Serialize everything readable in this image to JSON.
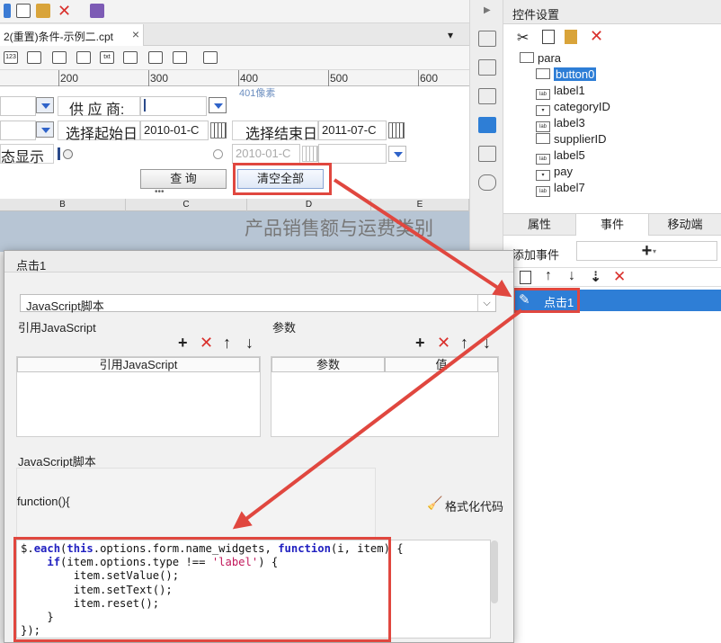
{
  "tab": {
    "title": "2(重置)条件-示例二.cpt",
    "close": "×"
  },
  "ruler": {
    "marks": [
      "200",
      "300",
      "400",
      "500",
      "600"
    ],
    "pixel_hint": "401像素"
  },
  "form": {
    "supplier_label": "供 应 商:",
    "start_label": "选择起始日",
    "start_value": "2010-01-C",
    "end_label": "选择结束日",
    "end_value": "2011-07-C",
    "status_label": "态显示",
    "date_placeholder": "2010-01-C",
    "query_button": "查 询",
    "clear_button": "清空全部"
  },
  "sheet": {
    "columns": [
      "B",
      "C",
      "D",
      "E"
    ],
    "report_title": "产品销售额与运费类别"
  },
  "right_panel": {
    "header": "控件设置",
    "tree": [
      {
        "name": "para",
        "icon": "form-icon"
      },
      {
        "name": "button0",
        "icon": "button-icon",
        "selected": true
      },
      {
        "name": "label1",
        "icon": "label-icon"
      },
      {
        "name": "categoryID",
        "icon": "combo-icon"
      },
      {
        "name": "label3",
        "icon": "label-icon"
      },
      {
        "name": "supplierID",
        "icon": "tree-icon"
      },
      {
        "name": "label5",
        "icon": "label-icon"
      },
      {
        "name": "pay",
        "icon": "combo-icon"
      },
      {
        "name": "label7",
        "icon": "label-icon"
      }
    ],
    "tabs": [
      "属性",
      "事件",
      "移动端"
    ],
    "add_event_label": "添加事件",
    "add_button": "+",
    "event_item": "点击1"
  },
  "dialog": {
    "title": "点击1",
    "type_value": "JavaScript脚本",
    "ref_section": "引用JavaScript",
    "param_section": "参数",
    "ref_header": "引用JavaScript",
    "param_header": "参数",
    "value_header": "值",
    "script_section": "JavaScript脚本",
    "function_label": "function(){",
    "format_button": "格式化代码"
  },
  "colors": {
    "highlight": "#e0473f",
    "selection": "#2e7ed6",
    "keyword": "#2020c0",
    "string": "#c2185b"
  }
}
